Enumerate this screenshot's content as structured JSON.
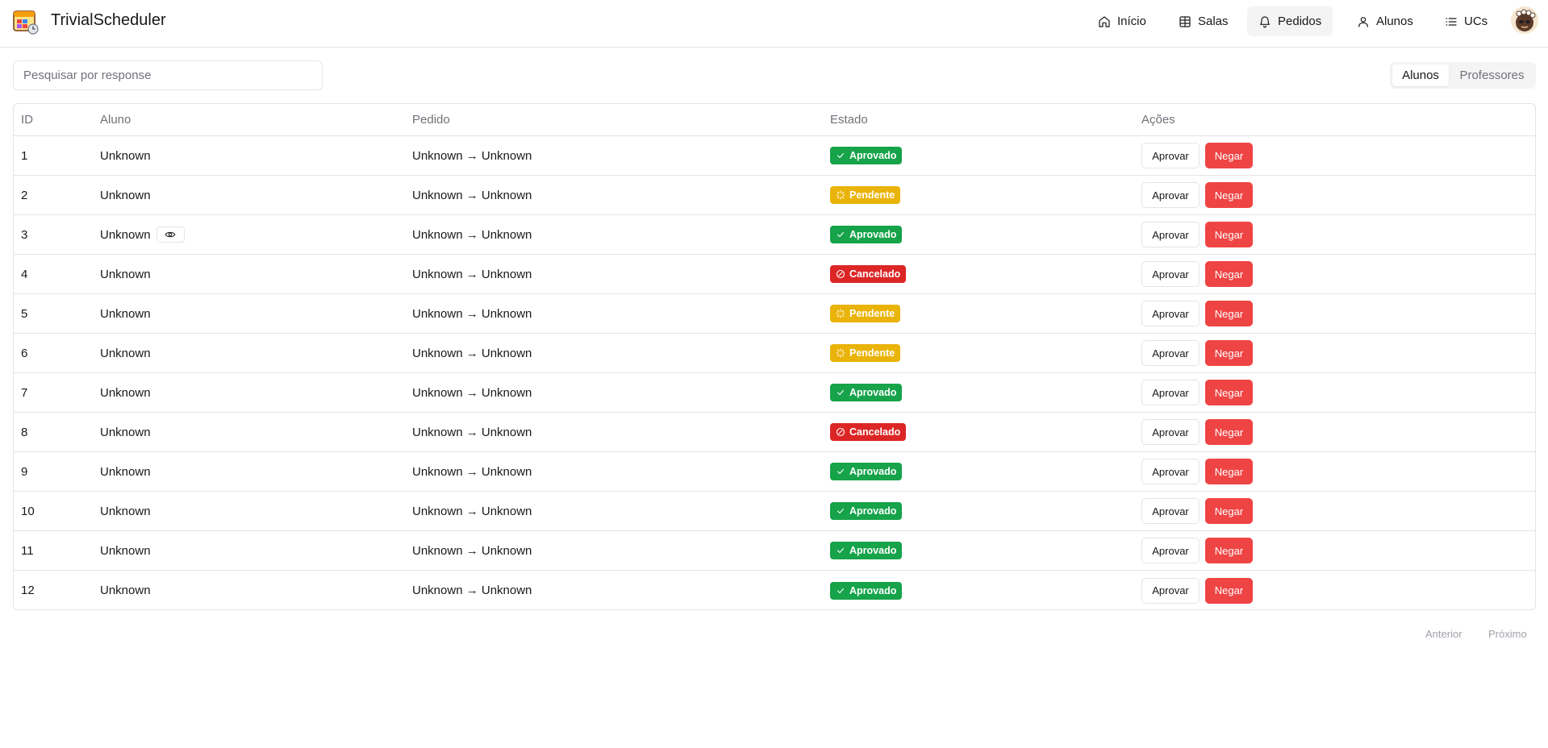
{
  "app": {
    "title": "TrivialScheduler"
  },
  "nav": [
    {
      "label": "Início",
      "icon": "home-icon"
    },
    {
      "label": "Salas",
      "icon": "table-grid-icon"
    },
    {
      "label": "Pedidos",
      "icon": "bell-icon",
      "active": true
    },
    {
      "label": "Alunos",
      "icon": "user-icon"
    },
    {
      "label": "UCs",
      "icon": "list-icon"
    }
  ],
  "search": {
    "placeholder": "Pesquisar por response",
    "value": ""
  },
  "toggle": {
    "options": [
      "Alunos",
      "Professores"
    ],
    "selected": "Alunos"
  },
  "table": {
    "headers": {
      "id": "ID",
      "aluno": "Aluno",
      "pedido": "Pedido",
      "estado": "Estado",
      "acoes": "Ações"
    },
    "rows": [
      {
        "id": "1",
        "aluno": "Unknown",
        "pedido": "Unknown → Unknown",
        "estado": "Aprovado"
      },
      {
        "id": "2",
        "aluno": "Unknown",
        "pedido": "Unknown → Unknown",
        "estado": "Pendente"
      },
      {
        "id": "3",
        "aluno": "Unknown",
        "pedido": "Unknown → Unknown",
        "estado": "Aprovado",
        "has_view": true
      },
      {
        "id": "4",
        "aluno": "Unknown",
        "pedido": "Unknown → Unknown",
        "estado": "Cancelado"
      },
      {
        "id": "5",
        "aluno": "Unknown",
        "pedido": "Unknown → Unknown",
        "estado": "Pendente"
      },
      {
        "id": "6",
        "aluno": "Unknown",
        "pedido": "Unknown → Unknown",
        "estado": "Pendente"
      },
      {
        "id": "7",
        "aluno": "Unknown",
        "pedido": "Unknown → Unknown",
        "estado": "Aprovado"
      },
      {
        "id": "8",
        "aluno": "Unknown",
        "pedido": "Unknown → Unknown",
        "estado": "Cancelado"
      },
      {
        "id": "9",
        "aluno": "Unknown",
        "pedido": "Unknown → Unknown",
        "estado": "Aprovado"
      },
      {
        "id": "10",
        "aluno": "Unknown",
        "pedido": "Unknown → Unknown",
        "estado": "Aprovado"
      },
      {
        "id": "11",
        "aluno": "Unknown",
        "pedido": "Unknown → Unknown",
        "estado": "Aprovado"
      },
      {
        "id": "12",
        "aluno": "Unknown",
        "pedido": "Unknown → Unknown",
        "estado": "Aprovado"
      }
    ]
  },
  "actions": {
    "approve_label": "Aprovar",
    "deny_label": "Negar"
  },
  "pagination": {
    "prev_label": "Anterior",
    "next_label": "Próximo"
  },
  "colors": {
    "aprovado": "#16a34a",
    "pendente": "#eab308",
    "cancelado": "#dc2626",
    "deny": "#ef4444"
  }
}
